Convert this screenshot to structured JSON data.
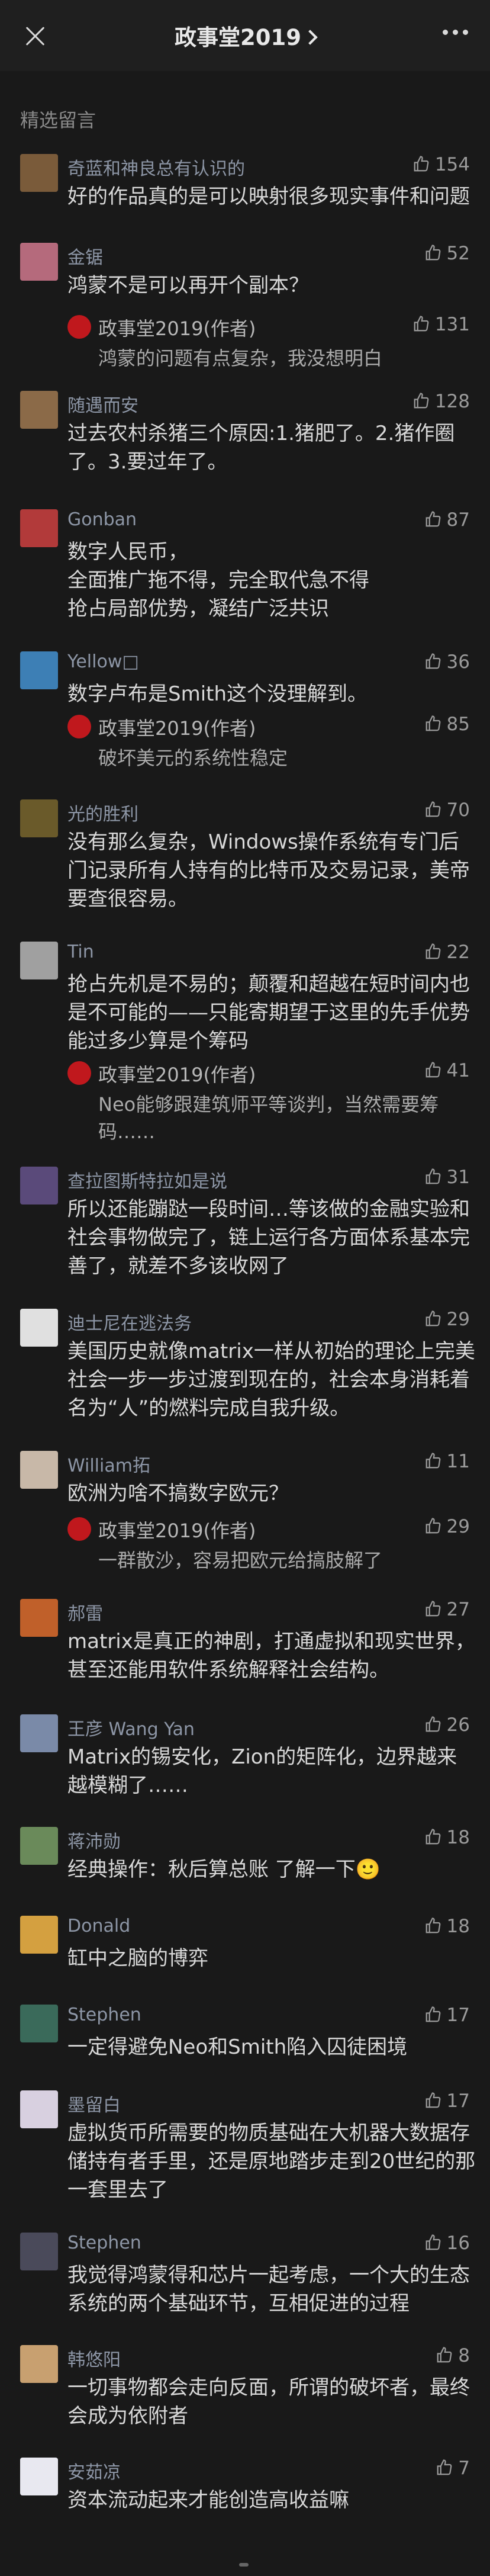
{
  "header": {
    "title": "政事堂2019",
    "close_icon": "close-icon",
    "more_icon": "more-icon"
  },
  "section_label": "精选留言",
  "comments": [
    {
      "name": "奇蓝和神良总有认识的",
      "likes": "154",
      "text": "好的作品真的是可以映射很多现实事件和问题",
      "avatar_color": "#7a5b3a"
    },
    {
      "name": "金锯",
      "likes": "52",
      "text": "鸿蒙不是可以再开个副本？",
      "avatar_color": "#b56a7c",
      "reply": {
        "name": "政事堂2019(作者)",
        "likes": "131",
        "text": "鸿蒙的问题有点复杂，我没想明白"
      }
    },
    {
      "name": "随遇而安",
      "likes": "128",
      "text": "过去农村杀猪三个原因:1.猪肥了。2.猪作圈了。3.要过年了。",
      "avatar_color": "#8b6a48"
    },
    {
      "name": "Gonban",
      "likes": "87",
      "text": "数字人民币，\n全面推广拖不得，完全取代急不得\n抢占局部优势，凝结广泛共识",
      "avatar_color": "#b23a3a"
    },
    {
      "name": "Yellow□",
      "likes": "36",
      "text": "数字卢布是Smith这个没理解到。",
      "avatar_color": "#3d7fb5",
      "reply": {
        "name": "政事堂2019(作者)",
        "likes": "85",
        "text": "破坏美元的系统性稳定"
      }
    },
    {
      "name": "光的胜利",
      "likes": "70",
      "text": "没有那么复杂，Windows操作系统有专门后门记录所有人持有的比特币及交易记录，美帝要查很容易。",
      "avatar_color": "#6a5a2a"
    },
    {
      "name": "Tin",
      "likes": "22",
      "text": "抢占先机是不易的；颠覆和超越在短时间内也是不可能的——只能寄期望于这里的先手优势能过多少算是个筹码",
      "avatar_color": "#a0a0a0",
      "reply": {
        "name": "政事堂2019(作者)",
        "likes": "41",
        "text": "Neo能够跟建筑师平等谈判，当然需要筹码……"
      }
    },
    {
      "name": "查拉图斯特拉如是说",
      "likes": "31",
      "text": "所以还能蹦跶一段时间…等该做的金融实验和社会事物做完了，链上运行各方面体系基本完善了，就差不多该收网了",
      "avatar_color": "#5a4a7a"
    },
    {
      "name": "迪士尼在逃法务",
      "likes": "29",
      "text": "美国历史就像matrix一样从初始的理论上完美社会一步一步过渡到现在的，社会本身消耗着名为“人”的燃料完成自我升级。",
      "avatar_color": "#e0e0e0"
    },
    {
      "name": "William拓",
      "likes": "11",
      "text": "欧洲为啥不搞数字欧元？",
      "avatar_color": "#c8b8a8",
      "reply": {
        "name": "政事堂2019(作者)",
        "likes": "29",
        "text": "一群散沙，容易把欧元给搞肢解了"
      }
    },
    {
      "name": "郝雷",
      "likes": "27",
      "text": "matrix是真正的神剧，打通虚拟和现实世界，甚至还能用软件系统解释社会结构。",
      "avatar_color": "#c0602a"
    },
    {
      "name": "王彦 Wang Yan",
      "likes": "26",
      "text": "Matrix的锡安化，Zion的矩阵化，边界越来越模糊了……",
      "avatar_color": "#7a8aa8"
    },
    {
      "name": "蒋沛勋",
      "likes": "18",
      "text": "经典操作：秋后算总账 了解一下🙂",
      "avatar_color": "#6a8a5a"
    },
    {
      "name": "Donald",
      "likes": "18",
      "text": "缸中之脑的博弈",
      "avatar_color": "#d4a040"
    },
    {
      "name": "Stephen",
      "likes": "17",
      "text": "一定得避免Neo和Smith陷入囚徒困境",
      "avatar_color": "#3a6a5a"
    },
    {
      "name": "墨留白",
      "likes": "17",
      "text": "虚拟货币所需要的物质基础在大机器大数据存储持有者手里，还是原地踏步走到20世纪的那一套里去了",
      "avatar_color": "#d8d0e0"
    },
    {
      "name": "Stephen",
      "likes": "16",
      "text": "我觉得鸿蒙得和芯片一起考虑，一个大的生态系统的两个基础环节，互相促进的过程",
      "avatar_color": "#4a4a5a"
    },
    {
      "name": "韩悠阳",
      "likes": "8",
      "text": "一切事物都会走向反面，所谓的破坏者，最终会成为依附者",
      "avatar_color": "#c8a070"
    },
    {
      "name": "安茹凉",
      "likes": "7",
      "text": "资本流动起来才能创造高收益嘛",
      "avatar_color": "#e8e8f0"
    }
  ],
  "layout_note": ""
}
